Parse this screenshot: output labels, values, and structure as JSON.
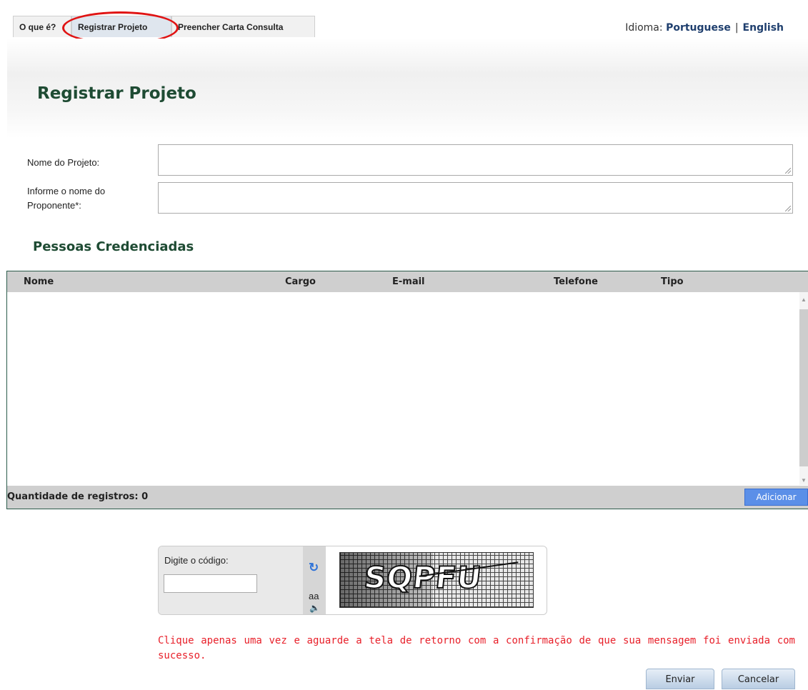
{
  "tabs": [
    {
      "label": "O que é?",
      "active": false
    },
    {
      "label": "Registrar Projeto",
      "active": true
    },
    {
      "label": "Preencher Carta Consulta",
      "active": false
    }
  ],
  "language": {
    "label": "Idioma:",
    "options": [
      "Portuguese",
      "English"
    ]
  },
  "page": {
    "title": "Registrar Projeto"
  },
  "form": {
    "project_name_label": "Nome do Projeto:",
    "project_name_value": "",
    "proponent_label_line1": "Informe o nome do",
    "proponent_label_line2": "Proponente*:",
    "proponent_value": ""
  },
  "people": {
    "title": "Pessoas Credenciadas",
    "columns": [
      "Nome",
      "Cargo",
      "E-mail",
      "Telefone",
      "Tipo"
    ],
    "rows": [],
    "count_label": "Quantidade de registros: 0",
    "add_label": "Adicionar"
  },
  "captcha": {
    "label": "Digite o código:",
    "value": "",
    "audio_label": "aa",
    "image_text": "SQPFU"
  },
  "notice": "Clique apenas uma vez e aguarde a tela de retorno com a confirmação de que sua mensagem foi enviada com sucesso.",
  "actions": {
    "submit_label": "Enviar",
    "cancel_label": "Cancelar"
  },
  "colors": {
    "title_green": "#1e4b33",
    "notice_red": "#e8202a",
    "add_button": "#5b8fe8",
    "annotation_ring": "#e01313"
  }
}
